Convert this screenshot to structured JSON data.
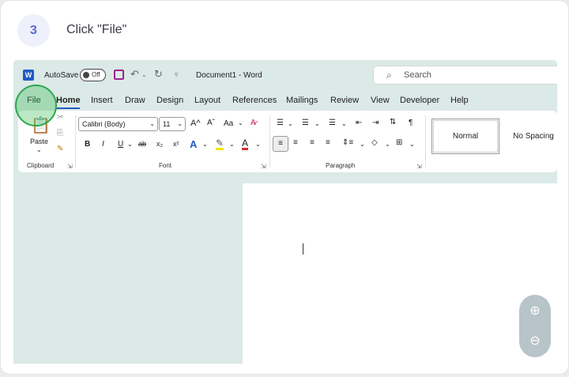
{
  "step": {
    "number": "3",
    "instruction": "Click \"File\""
  },
  "titlebar": {
    "app_letter": "W",
    "autosave_label": "AutoSave",
    "autosave_state": "Off",
    "doc_title": "Document1  -  Word",
    "search_placeholder": "Search"
  },
  "tabs": [
    "File",
    "Home",
    "Insert",
    "Draw",
    "Design",
    "Layout",
    "References",
    "Mailings",
    "Review",
    "View",
    "Developer",
    "Help"
  ],
  "active_tab": "Home",
  "ribbon": {
    "clipboard": {
      "paste_label": "Paste",
      "group_label": "Clipboard"
    },
    "font": {
      "font_name": "Calibri (Body)",
      "font_size": "11",
      "group_label": "Font",
      "grow": "A^",
      "shrink": "Aˇ",
      "case": "Aa",
      "bold": "B",
      "italic": "I",
      "underline": "U",
      "strike": "ab",
      "sub": "x₂",
      "sup": "x²",
      "effects": "A",
      "color": "A"
    },
    "paragraph": {
      "group_label": "Paragraph",
      "pilcrow": "¶"
    },
    "styles": [
      {
        "name": "Normal",
        "selected": true
      },
      {
        "name": "No Spacing",
        "selected": false
      }
    ]
  },
  "zoom": {
    "in_icon": "zoom-in-icon",
    "out_icon": "zoom-out-icon"
  },
  "colors": {
    "accent": "#5a67d8",
    "highlight": "#2aa84a",
    "word_blue": "#1f5bc4"
  }
}
